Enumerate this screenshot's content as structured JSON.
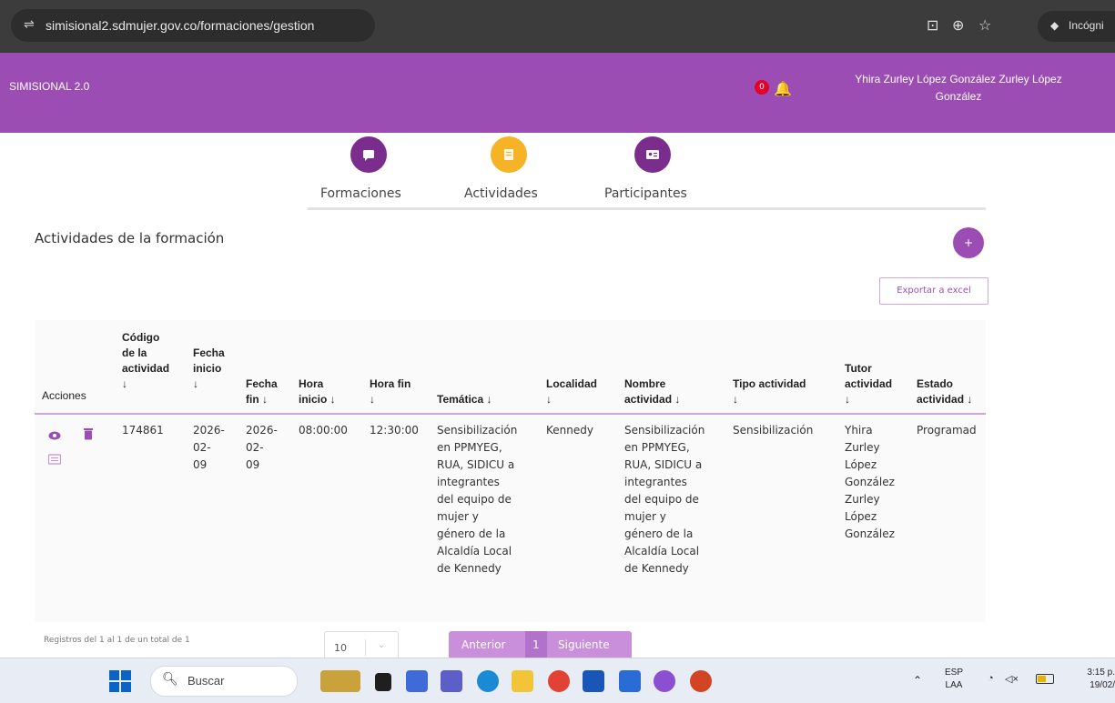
{
  "browser": {
    "url": "simisional2.sdmujer.gov.co/formaciones/gestion",
    "incognito_label": "Incógni"
  },
  "header": {
    "brand": "SIMISIONAL 2.0",
    "notification_count": "0",
    "user_line1": "Yhira Zurley López González Zurley López",
    "user_line2": "González"
  },
  "steps": [
    {
      "label": "Formaciones",
      "color": "#7b2d8e"
    },
    {
      "label": "Actividades",
      "color": "#f5b325"
    },
    {
      "label": "Participantes",
      "color": "#7b2d8e"
    }
  ],
  "section": {
    "title": "Actividades de la formación",
    "add_label": "+",
    "export_label": "Exportar a excel"
  },
  "table": {
    "headers": {
      "acciones": "Acciones",
      "codigo": "Código\nde la\nactividad\n↓",
      "fecha_inicio": "Fecha\ninicio\n↓",
      "fecha_fin": "Fecha\nfin ↓",
      "hora_inicio": "Hora\ninicio ↓",
      "hora_fin": "Hora fin\n↓",
      "tematica": "Temática ↓",
      "localidad": "Localidad\n↓",
      "nombre": "Nombre\nactividad ↓",
      "tipo": "Tipo actividad\n↓",
      "tutor": "Tutor\nactividad\n↓",
      "estado": "Estado\nactividad ↓"
    },
    "row": {
      "codigo": "174861",
      "fecha_inicio": "2026-\n02-\n09",
      "fecha_fin": "2026-\n02-\n09",
      "hora_inicio": "08:00:00",
      "hora_fin": "12:30:00",
      "tematica": "Sensibilización\nen PPMYEG,\nRUA, SIDICU a\nintegrantes\ndel equipo de\nmujer y\ngénero de la\nAlcaldía Local\nde Kennedy",
      "localidad": "Kennedy",
      "nombre": "Sensibilización\nen PPMYEG,\nRUA, SIDICU a\nintegrantes\ndel equipo de\nmujer y\ngénero de la\nAlcaldía Local\nde Kennedy",
      "tipo": "Sensibilización",
      "tutor": "Yhira\nZurley\nLópez\nGonzález\nZurley\nLópez\nGonzález",
      "estado": "Programad"
    }
  },
  "pagination": {
    "records_text": "Registros del 1 al 1 de un total de 1",
    "page_size": "10",
    "prev_label": "Anterior",
    "current_page": "1",
    "next_label": "Siguiente"
  },
  "taskbar": {
    "search_label": "Buscar",
    "lang_line1": "ESP",
    "lang_line2": "LAA",
    "time": "3:15 p.",
    "date": "19/02/"
  },
  "colors": {
    "brand_purple": "#9c4db3",
    "accent_yellow": "#f5b325"
  }
}
